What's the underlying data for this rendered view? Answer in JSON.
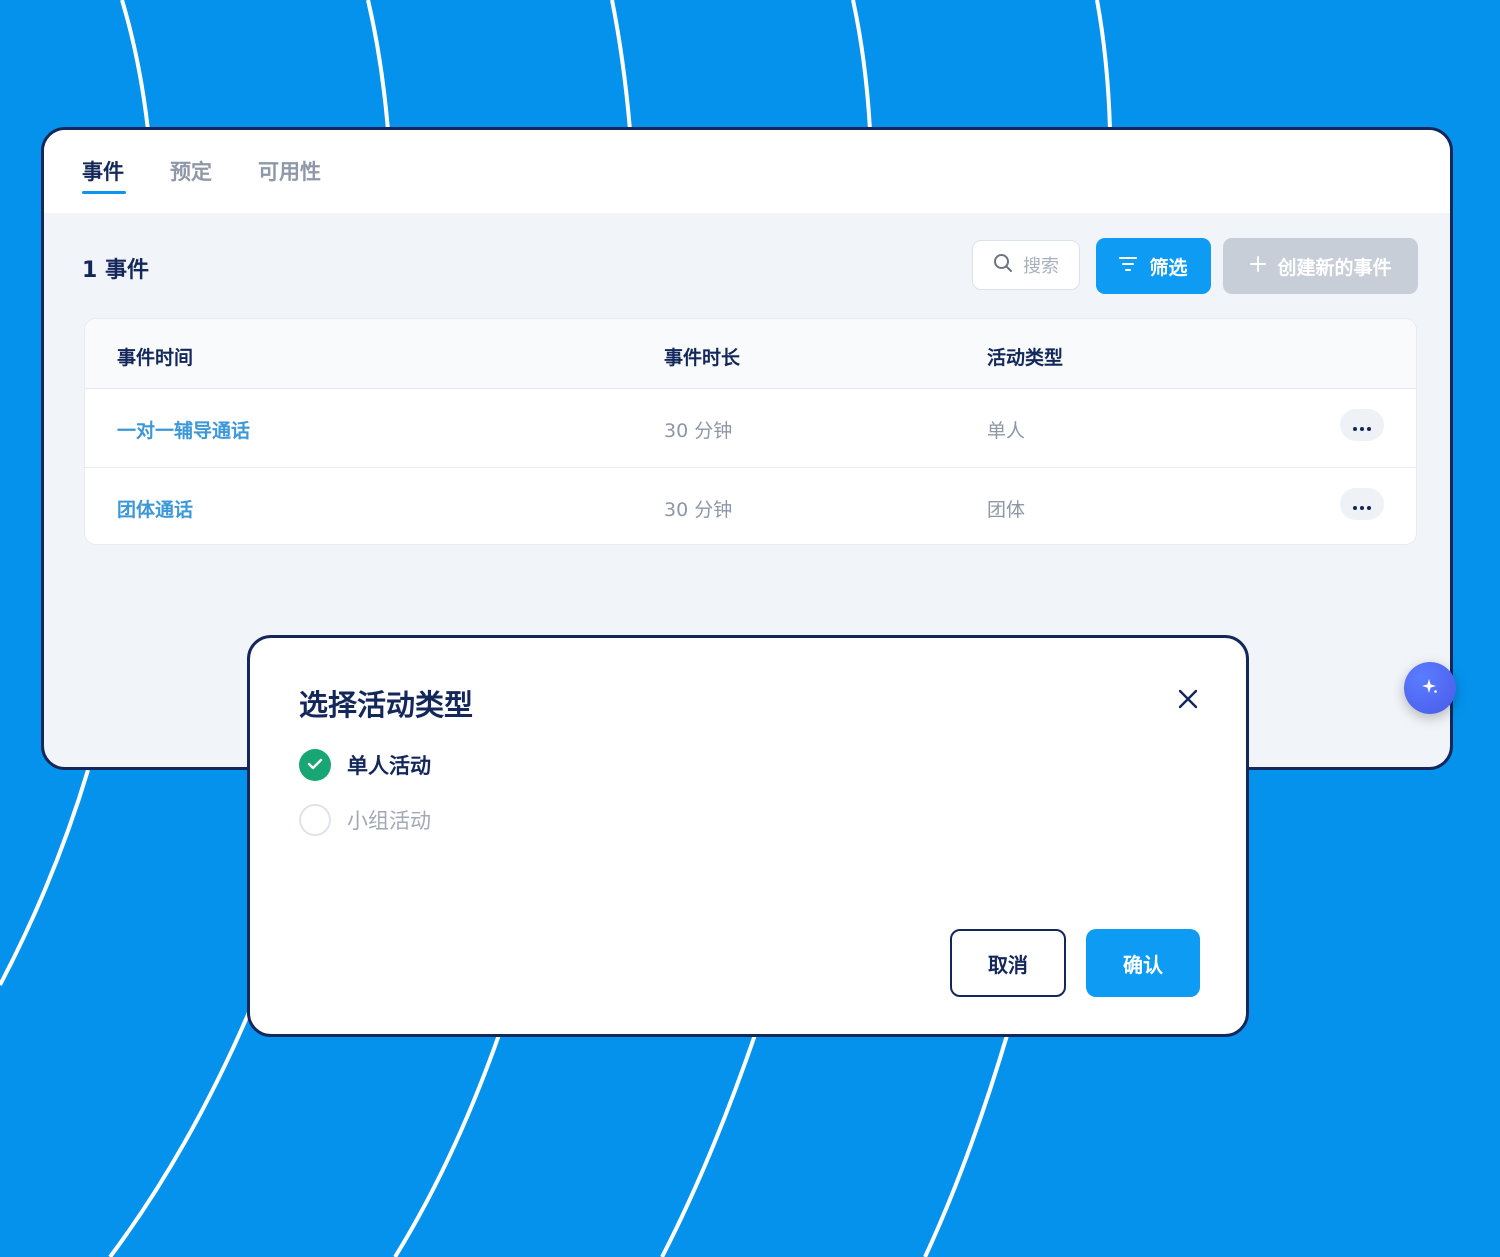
{
  "tabs": [
    {
      "label": "事件",
      "active": true
    },
    {
      "label": "预定",
      "active": false
    },
    {
      "label": "可用性",
      "active": false
    }
  ],
  "toolbar": {
    "count_title": "1 事件",
    "search_placeholder": "搜索",
    "filter_label": "筛选",
    "create_label": "创建新的事件"
  },
  "table": {
    "headers": [
      "事件时间",
      "事件时长",
      "活动类型"
    ],
    "rows": [
      {
        "name": "一对一辅导通话",
        "duration": "30 分钟",
        "type": "单人"
      },
      {
        "name": "团体通话",
        "duration": "30 分钟",
        "type": "团体"
      }
    ]
  },
  "modal": {
    "title": "选择活动类型",
    "options": [
      {
        "label": "单人活动",
        "selected": true
      },
      {
        "label": "小组活动",
        "selected": false
      }
    ],
    "cancel_label": "取消",
    "confirm_label": "确认"
  },
  "colors": {
    "background": "#0592ec",
    "navy": "#13275a",
    "accent": "#0e9bf3",
    "success": "#18a774",
    "link": "#3d98d8"
  },
  "icons": [
    "search-icon",
    "filter-icon",
    "plus-icon",
    "more-icon",
    "sparkle-icon",
    "close-icon",
    "check-icon"
  ]
}
